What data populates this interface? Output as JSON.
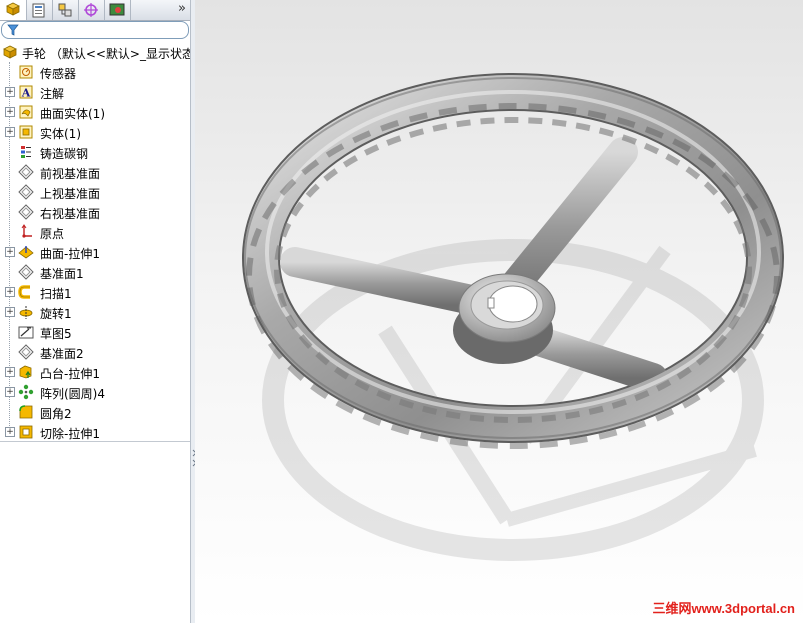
{
  "featuremanager": {
    "tabs": [
      {
        "icon": "feature-manager-icon"
      },
      {
        "icon": "property-manager-icon"
      },
      {
        "icon": "configuration-manager-icon"
      },
      {
        "icon": "dimxpert-manager-icon"
      },
      {
        "icon": "display-manager-icon"
      }
    ],
    "more_glyph": "»",
    "root": {
      "label": "手轮 （默认<<默认>_显示状态",
      "icon": "part-icon"
    },
    "items": [
      {
        "label": "传感器",
        "icon": "sensor-icon",
        "expandable": false
      },
      {
        "label": "注解",
        "icon": "annotation-icon",
        "expandable": true
      },
      {
        "label": "曲面实体(1)",
        "icon": "surface-body-icon",
        "expandable": true
      },
      {
        "label": "实体(1)",
        "icon": "solid-body-icon",
        "expandable": true
      },
      {
        "label": "铸造碳钢",
        "icon": "material-icon",
        "expandable": false
      },
      {
        "label": "前视基准面",
        "icon": "plane-icon",
        "expandable": false
      },
      {
        "label": "上视基准面",
        "icon": "plane-icon",
        "expandable": false
      },
      {
        "label": "右视基准面",
        "icon": "plane-icon",
        "expandable": false
      },
      {
        "label": "原点",
        "icon": "origin-icon",
        "expandable": false
      },
      {
        "label": "曲面-拉伸1",
        "icon": "surface-extrude-icon",
        "expandable": true
      },
      {
        "label": "基准面1",
        "icon": "plane-icon",
        "expandable": false
      },
      {
        "label": "扫描1",
        "icon": "sweep-icon",
        "expandable": true
      },
      {
        "label": "旋转1",
        "icon": "revolve-icon",
        "expandable": true
      },
      {
        "label": "草图5",
        "icon": "sketch-icon",
        "expandable": false
      },
      {
        "label": "基准面2",
        "icon": "plane-icon",
        "expandable": false
      },
      {
        "label": "凸台-拉伸1",
        "icon": "boss-extrude-icon",
        "expandable": true
      },
      {
        "label": "阵列(圆周)4",
        "icon": "circular-pattern-icon",
        "expandable": true
      },
      {
        "label": "圆角2",
        "icon": "fillet-icon",
        "expandable": false
      },
      {
        "label": "切除-拉伸1",
        "icon": "cut-extrude-icon",
        "expandable": true
      }
    ]
  },
  "watermark": "三维网www.3dportal.cn",
  "colors": {
    "accent": "#f5b800",
    "model": "#9c9c9c",
    "watermark": "#e2211c"
  }
}
